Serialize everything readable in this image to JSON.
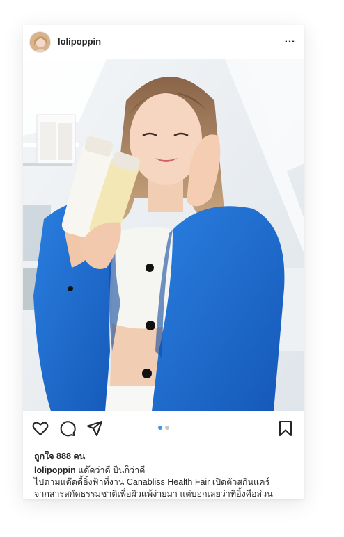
{
  "post": {
    "username": "lolipoppin",
    "more_label": "…",
    "image_alt": "Woman in a blue blazer holding skincare bottles",
    "likes_text": "ถูกใจ 888 คน",
    "caption_user": "lolipoppin",
    "caption_first": "แด๊ดว่าดี ปีนก็ว่าดี",
    "caption_lines": [
      "ไปตามแด๊ดดี้อิ้งฟ้าที่งาน Canabliss Health Fair เปิดตัวสกินแคร์",
      "จากสารสกัดธรรมชาติเพื่อผิวแพ้ง่ายมา  แต่บอกเลยว่าที่อิ้งคือส่วน"
    ]
  },
  "carousel": {
    "count": 2,
    "active": 1
  },
  "icons": {
    "like": "heart-icon",
    "comment": "comment-icon",
    "share": "share-icon",
    "save": "bookmark-icon"
  },
  "colors": {
    "accent": "#3897f0",
    "text": "#262626",
    "blazer": "#1f6fd1"
  }
}
